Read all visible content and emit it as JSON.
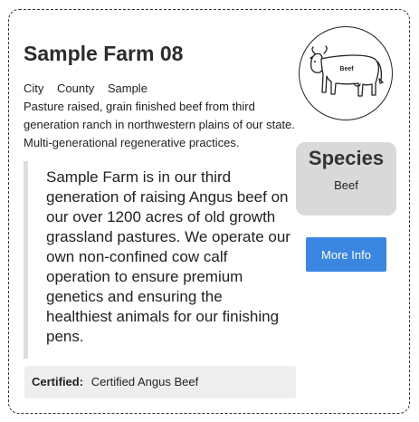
{
  "farm": {
    "title": "Sample Farm 08",
    "city": "City",
    "county": "County",
    "state": "Sample",
    "description": "Pasture raised, grain finished beef from third generation ranch in northwestern plains of our state. Multi-generational regenerative practices.",
    "story": "Sample Farm is in our third generation of raising Angus beef on our over 1200 acres of old growth grassland pastures. We operate our own non-confined cow calf operation to ensure premium genetics and ensuring the healthiest animals for our finishing pens.",
    "certified_label": "Certified:",
    "certified_value": "Certified Angus Beef"
  },
  "logo": {
    "icon": "cow-icon",
    "text": "Beef"
  },
  "species": {
    "title": "Species",
    "value": "Beef"
  },
  "actions": {
    "more_info_label": "More Info"
  },
  "colors": {
    "button": "#3a86e0",
    "species_box": "#d9d9d9",
    "certified_bg": "#eeeeee",
    "quote_border": "#dddddd"
  }
}
